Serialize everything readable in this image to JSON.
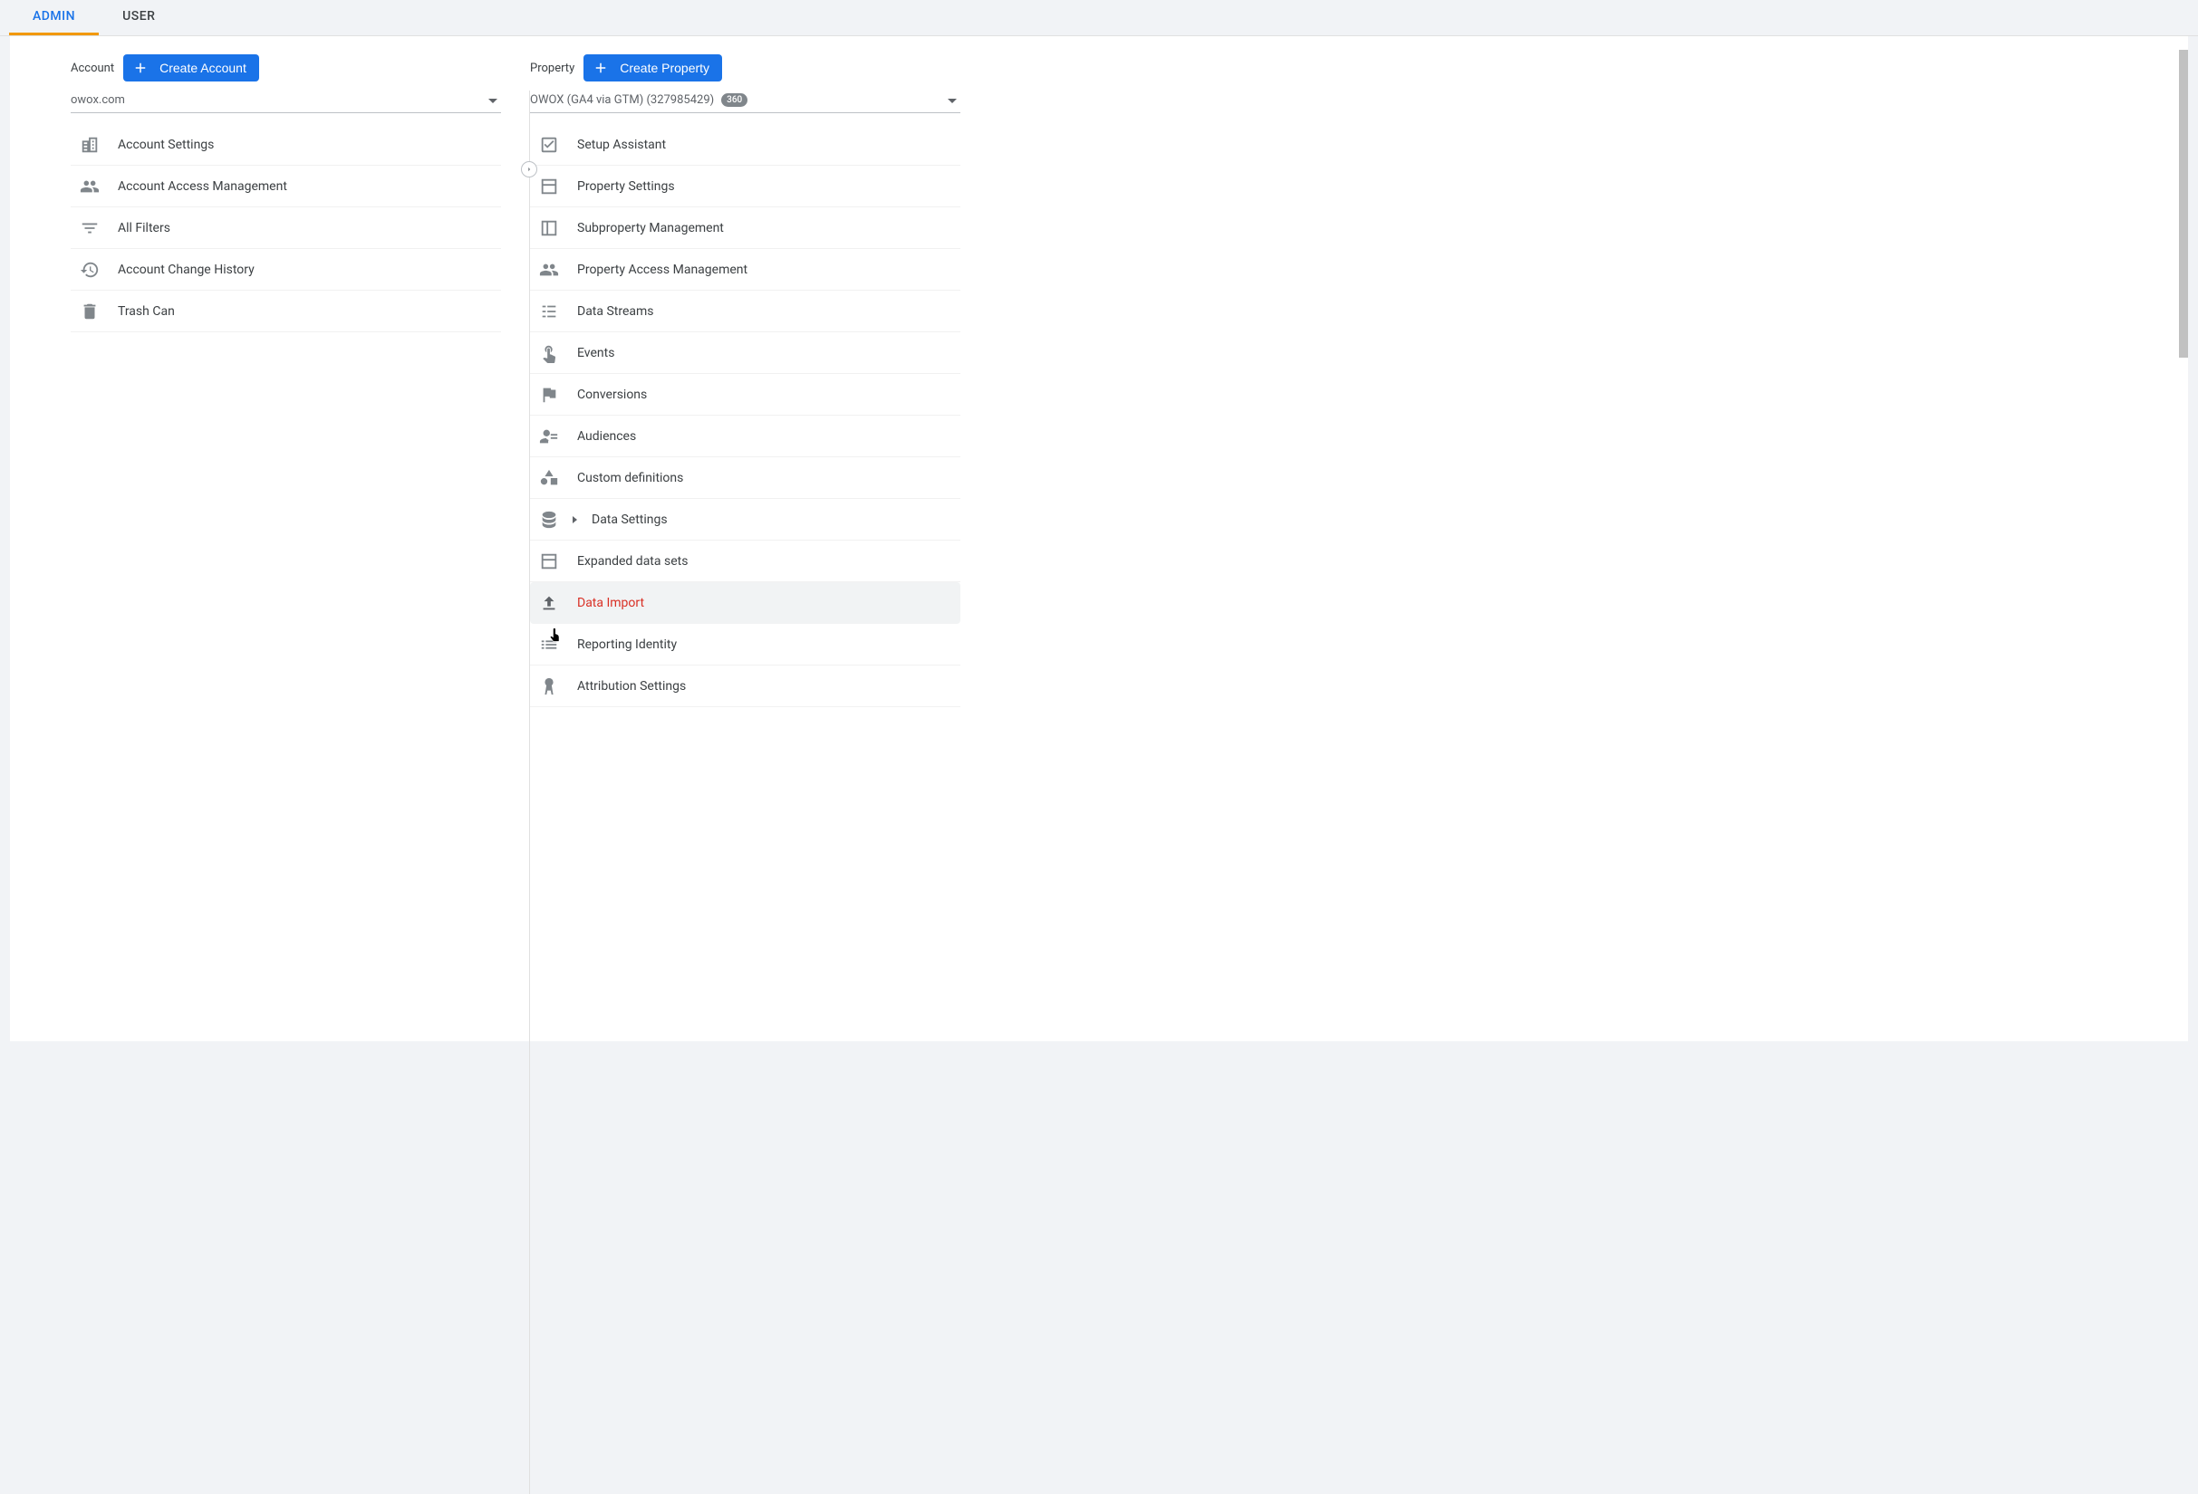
{
  "tabs": {
    "admin": "ADMIN",
    "user": "USER"
  },
  "account": {
    "header_label": "Account",
    "create_label": "Create Account",
    "selector_name": "owox.com",
    "items": [
      {
        "label": "Account Settings"
      },
      {
        "label": "Account Access Management"
      },
      {
        "label": "All Filters"
      },
      {
        "label": "Account Change History"
      },
      {
        "label": "Trash Can"
      }
    ]
  },
  "property": {
    "header_label": "Property",
    "create_label": "Create Property",
    "selector_name": "OWOX (GA4 via GTM) (327985429)",
    "badge": "360",
    "items": [
      {
        "label": "Setup Assistant"
      },
      {
        "label": "Property Settings"
      },
      {
        "label": "Subproperty Management"
      },
      {
        "label": "Property Access Management"
      },
      {
        "label": "Data Streams"
      },
      {
        "label": "Events"
      },
      {
        "label": "Conversions"
      },
      {
        "label": "Audiences"
      },
      {
        "label": "Custom definitions"
      },
      {
        "label": "Data Settings"
      },
      {
        "label": "Expanded data sets"
      },
      {
        "label": "Data Import"
      },
      {
        "label": "Reporting Identity"
      },
      {
        "label": "Attribution Settings"
      }
    ]
  }
}
